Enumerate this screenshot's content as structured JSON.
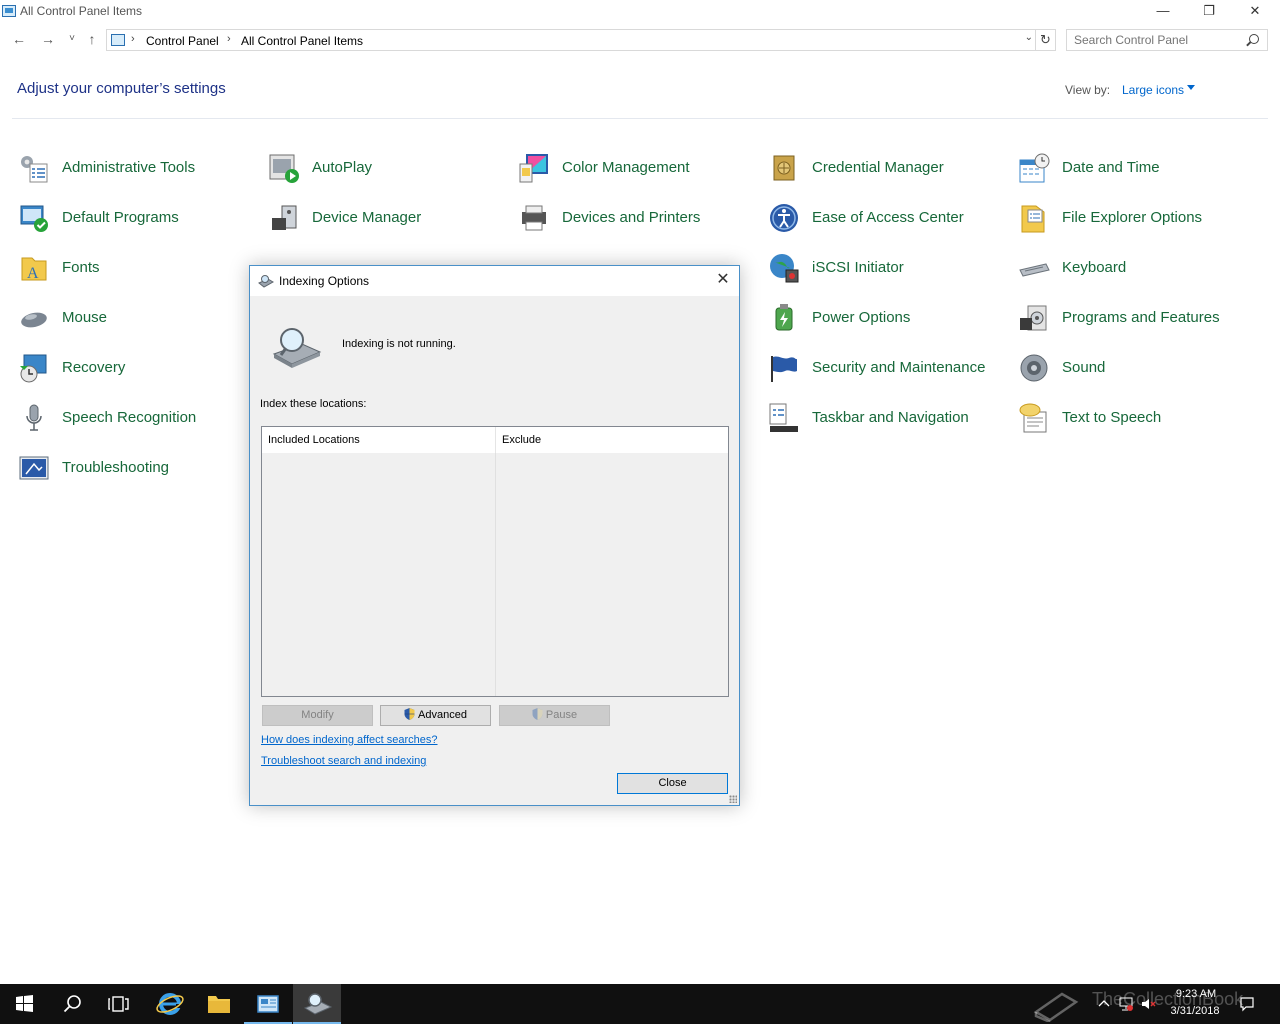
{
  "window": {
    "title": "All Control Panel Items",
    "minimize": "—",
    "maximize": "❐",
    "close": "✕"
  },
  "nav": {
    "back": "←",
    "forward": "→",
    "recent": "˅",
    "up": "↑",
    "breadcrumb": [
      "Control Panel",
      "All Control Panel Items"
    ],
    "separator": "›",
    "dropdown": "⌄",
    "refresh": "↻",
    "search_placeholder": "Search Control Panel"
  },
  "header": {
    "title": "Adjust your computer’s settings",
    "view_by_label": "View by:",
    "view_by_value": "Large icons"
  },
  "items": [
    {
      "label": "Administrative Tools",
      "icon": "administrative-tools-icon"
    },
    {
      "label": "AutoPlay",
      "icon": "autoplay-icon"
    },
    {
      "label": "Color Management",
      "icon": "color-management-icon"
    },
    {
      "label": "Credential Manager",
      "icon": "credential-manager-icon"
    },
    {
      "label": "Date and Time",
      "icon": "date-time-icon"
    },
    {
      "label": "Default Programs",
      "icon": "default-programs-icon"
    },
    {
      "label": "Device Manager",
      "icon": "device-manager-icon"
    },
    {
      "label": "Devices and Printers",
      "icon": "devices-printers-icon"
    },
    {
      "label": "Ease of Access Center",
      "icon": "ease-of-access-icon"
    },
    {
      "label": "File Explorer Options",
      "icon": "file-explorer-options-icon"
    },
    {
      "label": "Fonts",
      "icon": "fonts-icon"
    },
    {
      "label": "iSCSI Initiator",
      "icon": "iscsi-icon"
    },
    {
      "label": "Keyboard",
      "icon": "keyboard-icon"
    },
    {
      "label": "Mouse",
      "icon": "mouse-icon"
    },
    {
      "label": "Power Options",
      "icon": "power-options-icon"
    },
    {
      "label": "Programs and Features",
      "icon": "programs-features-icon"
    },
    {
      "label": "Recovery",
      "icon": "recovery-icon"
    },
    {
      "label": "Security and Maintenance",
      "icon": "security-maintenance-icon"
    },
    {
      "label": "Sound",
      "icon": "sound-icon"
    },
    {
      "label": "Speech Recognition",
      "icon": "speech-recognition-icon"
    },
    {
      "label": "Taskbar and Navigation",
      "icon": "taskbar-navigation-icon"
    },
    {
      "label": "Text to Speech",
      "icon": "text-to-speech-icon"
    },
    {
      "label": "Troubleshooting",
      "icon": "troubleshooting-icon"
    }
  ],
  "dialog": {
    "title": "Indexing Options",
    "close": "✕",
    "status": "Indexing is not running.",
    "locations_label": "Index these locations:",
    "columns": [
      "Included Locations",
      "Exclude"
    ],
    "buttons": {
      "modify": "Modify",
      "advanced": "Advanced",
      "pause": "Pause",
      "close": "Close"
    },
    "links": [
      "How does indexing affect searches?",
      "Troubleshoot search and indexing"
    ]
  },
  "taskbar": {
    "time": "9:23 AM",
    "date": "3/31/2018",
    "watermark": "TheCollectionBook"
  },
  "colors": {
    "item_link": "#17683a",
    "title_blue": "#1e3287",
    "link_blue": "#0066cc",
    "taskbar": "#101010",
    "dialog_bg": "#f0f0f0"
  }
}
